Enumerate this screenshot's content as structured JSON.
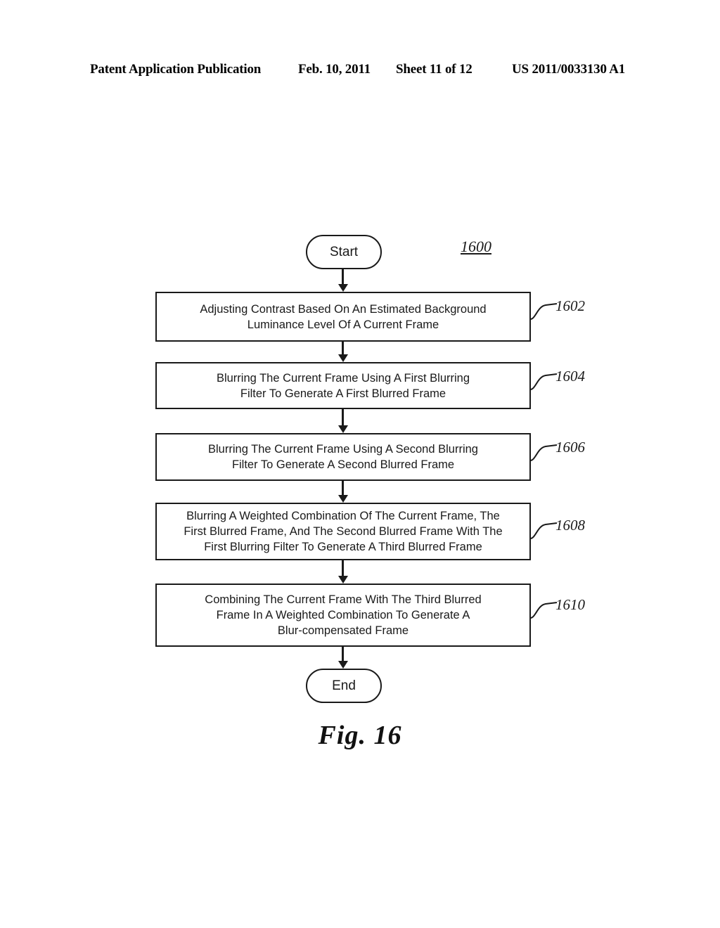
{
  "header": {
    "publication": "Patent Application Publication",
    "date": "Feb. 10, 2011",
    "sheet": "Sheet 11 of 12",
    "patent_number": "US 2011/0033130 A1"
  },
  "figure": {
    "caption": "Fig. 16",
    "diagram_ref": "1600"
  },
  "flowchart": {
    "start_label": "Start",
    "end_label": "End",
    "steps": [
      {
        "ref": "1602",
        "text": "Adjusting Contrast Based On An Estimated Background\nLuminance Level Of A Current Frame"
      },
      {
        "ref": "1604",
        "text": "Blurring The Current Frame Using A First Blurring\nFilter To Generate A First Blurred Frame"
      },
      {
        "ref": "1606",
        "text": "Blurring The Current Frame Using A Second Blurring\nFilter To Generate A Second Blurred Frame"
      },
      {
        "ref": "1608",
        "text": "Blurring A Weighted Combination Of The Current Frame, The\nFirst Blurred Frame, And The Second Blurred Frame With The\nFirst Blurring Filter To Generate A Third Blurred  Frame"
      },
      {
        "ref": "1610",
        "text": "Combining The Current Frame With The Third Blurred\nFrame In A  Weighted Combination To Generate A\nBlur-compensated Frame"
      }
    ]
  },
  "colors": {
    "ink": "#1a1a1a",
    "background": "#ffffff"
  }
}
